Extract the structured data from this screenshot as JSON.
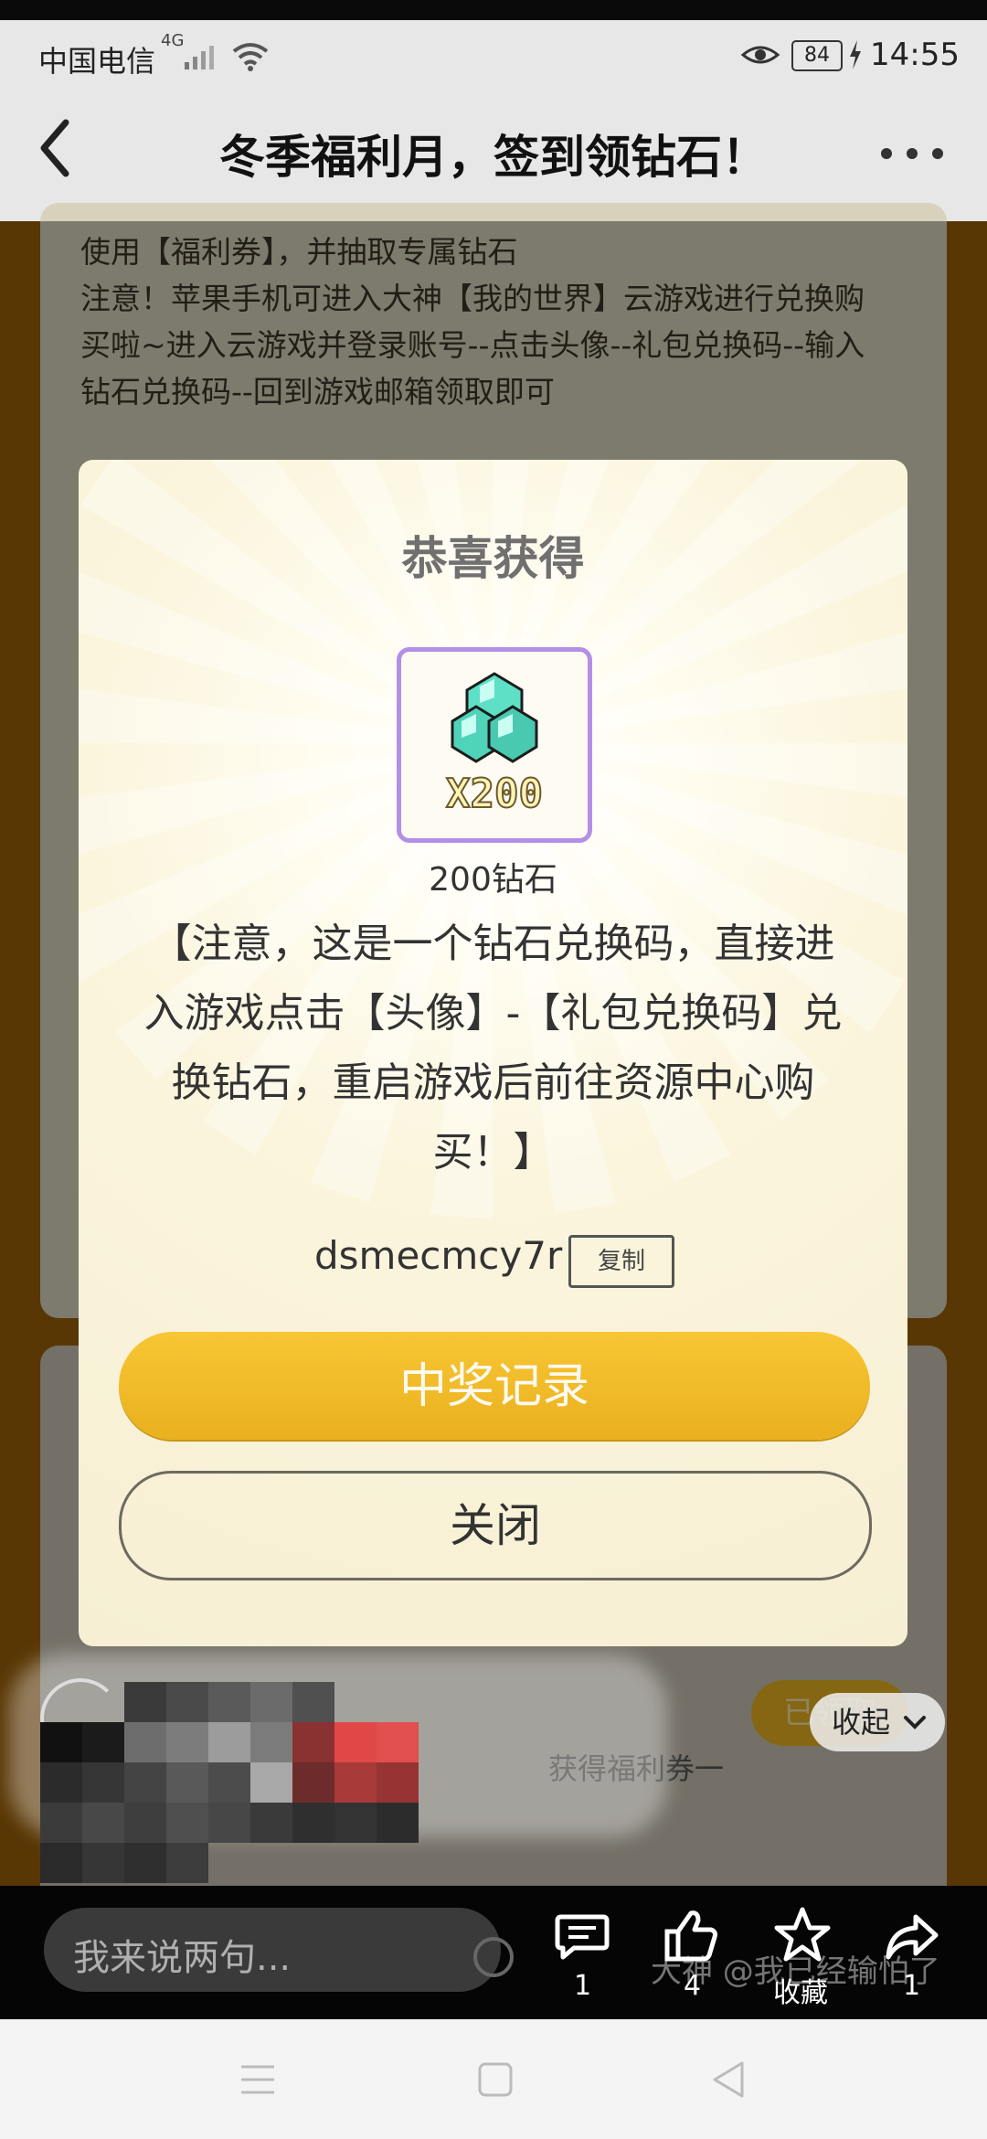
{
  "status_bar": {
    "carrier": "中国电信",
    "network": "4G",
    "battery": "84",
    "time": "14:55"
  },
  "title_bar": {
    "title": "冬季福利月，签到领钻石！",
    "back_icon": "chevron-left-icon",
    "more_icon": "more-horizontal-icon"
  },
  "page": {
    "intro_lines": [
      "使用【福利券】，并抽取专属钻石",
      "注意！苹果手机可进入大神【我的世界】云游戏进行兑换购",
      "买啦~进入云游戏并登录账号--点击头像--礼包兑换码--输入",
      "钻石兑换码--回到游戏邮箱领取即可"
    ],
    "behind_text": "获得福利券一",
    "behind_button": "已领取",
    "collapse_label": "收起"
  },
  "modal": {
    "title": "恭喜获得",
    "reward_badge": "X200",
    "reward_name": "200钻石",
    "notice_lines": [
      "【注意，这是一个钻石兑换码，直接进",
      "入游戏点击【头像】-【礼包兑换码】兑",
      "换钻石，重启游戏后前往资源中心购",
      "买！】"
    ],
    "code": "dsmecmcy7r",
    "copy_label": "复制",
    "record_button": "中奖记录",
    "close_button": "关闭"
  },
  "comment_bar": {
    "placeholder": "我来说两句...",
    "comment_count": "1",
    "like_count": "4",
    "favorite_label": "收藏",
    "share_count": "1",
    "watermark": "大神 @我已经输怕了"
  },
  "colors": {
    "accent_gold": "#f0b928",
    "modal_bg": "#fbf5dd",
    "reward_border": "#b38fe6"
  }
}
